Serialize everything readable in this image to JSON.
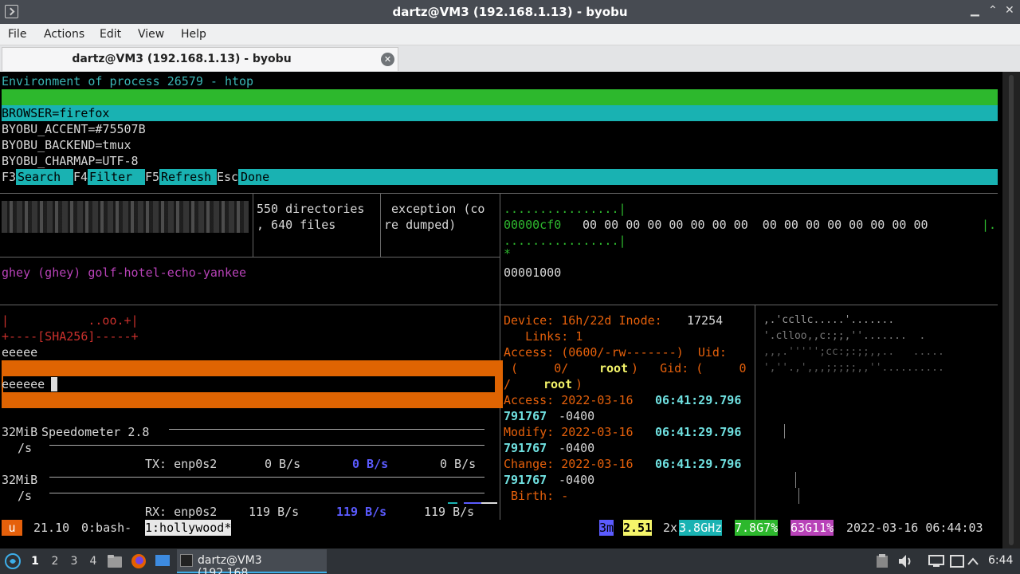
{
  "window": {
    "title": "dartz@VM3 (192.168.1.13) - byobu",
    "min": "▁",
    "max": "⌃",
    "close": "✕"
  },
  "menu": {
    "file": "File",
    "actions": "Actions",
    "edit": "Edit",
    "view": "View",
    "help": "Help"
  },
  "tab": {
    "label": "dartz@VM3 (192.168.1.13) - byobu",
    "close": "✕"
  },
  "htop": {
    "header": "Environment of process 26579 - htop",
    "env": [
      "BROWSER=firefox",
      "BYOBU_ACCENT=#75507B",
      "BYOBU_BACKEND=tmux",
      "BYOBU_CHARMAP=UTF-8"
    ],
    "f3": "F3",
    "search": "Search ",
    "f4": "F4",
    "filter": "Filter ",
    "f5": "F5",
    "refresh": "Refresh",
    "esc": "Esc",
    "done": "Done"
  },
  "pane_tree": {
    "line1": "550 directories",
    "line2": ", 640 files"
  },
  "pane_exception": {
    "line1": " exception (co",
    "line2": "re dumped)"
  },
  "pane_hexdump": {
    "dots1": "................|",
    "offset": "00000cf0",
    "bytes": " 00 00 00 00 00 00 00 00  00 00 00 00 00 00 00 00",
    "tail": "|.",
    "dots2": "................|",
    "star": "*",
    "end_offset": "00001000"
  },
  "pane_user": {
    "text": "ghey (ghey) golf-hotel-echo-yankee"
  },
  "pane_sha": {
    "line1": "|           ..oo.+|",
    "line2": "+----[SHA256]-----+",
    "line3": "eeeee",
    "input": "eeeeee"
  },
  "pane_speed": {
    "y_top": "32MiB",
    "y_top_unit": "/s",
    "title": "Speedometer 2.8",
    "y_bottom": "32MiB",
    "y_bottom_unit": "/s",
    "tx_label": "TX: enp0s2",
    "tx_cur": "0 B/s",
    "tx_avg": "0 B/s",
    "tx_max": "0 B/s",
    "rx_label": "RX: enp0s2",
    "rx_cur": "119 B/s",
    "rx_avg": "119 B/s",
    "rx_max": "119 B/s"
  },
  "pane_stat": {
    "device_label": "Device: 16h/22d Inode: ",
    "inode": "17254",
    "links": "   Links: 1",
    "access_perm": "Access: (0600/-rw-------)  Uid:",
    "uid_open": " (     0/     ",
    "uid_name": "root",
    "gid": ")   Gid: (     0",
    "gid_slash": "/     ",
    "gid_name": "root",
    "gid_close": ")",
    "access_label": "Access: 2022-03-16 ",
    "access_time": "06:41:29.796",
    "access_ns": "791767",
    "access_tz": " -0400",
    "modify_label": "Modify: 2022-03-16 ",
    "modify_time": "06:41:29.796",
    "modify_ns": "791767",
    "modify_tz": " -0400",
    "change_label": "Change: 2022-03-16 ",
    "change_time": "06:41:29.796",
    "change_ns": "791767",
    "change_tz": " -0400",
    "birth": " Birth: -"
  },
  "pane_ascii": {
    "lines": [
      " ,.'ccllc.....'.......",
      " '.clloo,,c:;;,''.......  .",
      " ,,,.''''';cc:;:;;,,..   .....",
      " ',''.,',,,;;;;;,,''.........."
    ]
  },
  "status": {
    "session_icon": "u",
    "version": "21.10",
    "win0": "0:bash-",
    "win1": "1:hollywood*",
    "uptime": "3m",
    "load": "2.51",
    "cpu_count": "2x",
    "cpu_freq": "3.8GHz",
    "mem": "7.8G7%",
    "disk": "63G11%",
    "datetime": "2022-03-16 06:44:03"
  },
  "taskbar": {
    "ws1": "1",
    "ws2": "2",
    "ws3": "3",
    "ws4": "4",
    "task": "dartz@VM3 (192.168....",
    "clock": "6:44"
  },
  "colors": {
    "term_bg": "#000000",
    "cyan_bar": "#19b2b2",
    "green_bar": "#2db82d",
    "orange_border": "#df6402",
    "magenta": "#b842b8",
    "status_orange": "#e5600b"
  }
}
